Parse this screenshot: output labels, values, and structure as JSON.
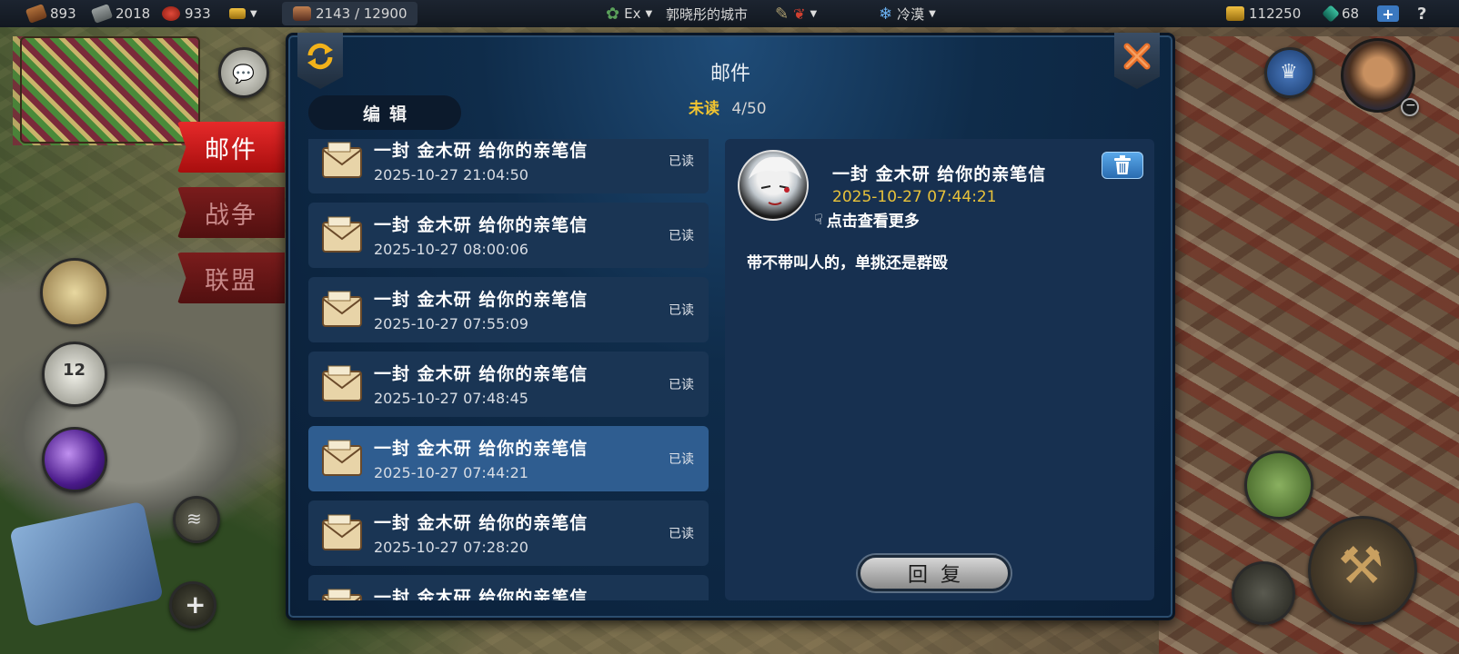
{
  "topbar": {
    "wood": "893",
    "stone": "2018",
    "food": "933",
    "population": "2143 / 12900",
    "mode": "Ex",
    "city_name": "郭晓彤的城市",
    "weather": "冷漠",
    "gold": "112250",
    "gems": "68",
    "help": "?"
  },
  "side_tabs": {
    "mail": "邮件",
    "war": "战争",
    "alliance": "联盟"
  },
  "panel": {
    "title": "邮件",
    "edit_label": "编辑",
    "unread_label": "未读",
    "unread_count": "4/50"
  },
  "mail_list": [
    {
      "subject": "一封 金木研 给你的亲笔信",
      "time": "2025-10-27 21:04:50",
      "status": "已读"
    },
    {
      "subject": "一封 金木研 给你的亲笔信",
      "time": "2025-10-27 08:00:06",
      "status": "已读"
    },
    {
      "subject": "一封 金木研 给你的亲笔信",
      "time": "2025-10-27 07:55:09",
      "status": "已读"
    },
    {
      "subject": "一封 金木研 给你的亲笔信",
      "time": "2025-10-27 07:48:45",
      "status": "已读"
    },
    {
      "subject": "一封 金木研 给你的亲笔信",
      "time": "2025-10-27 07:44:21",
      "status": "已读"
    },
    {
      "subject": "一封 金木研 给你的亲笔信",
      "time": "2025-10-27 07:28:20",
      "status": "已读"
    },
    {
      "subject": "一封 金木研 给你的亲笔信",
      "time": "",
      "status": ""
    }
  ],
  "detail": {
    "subject": "一封 金木研 给你的亲笔信",
    "time": "2025-10-27 07:44:21",
    "more_label": "点击查看更多",
    "body": "带不带叫人的，单挑还是群殴",
    "reply_label": "回复"
  },
  "icons": {
    "refresh": "refresh-icon",
    "close": "close-icon",
    "trash": "trash-icon",
    "envelope": "envelope-icon"
  },
  "colors": {
    "accent_yellow": "#f2c530",
    "tab_red": "#d81e1e",
    "panel_blue": "#0f2c4a",
    "selected_row": "#2f5d90"
  }
}
